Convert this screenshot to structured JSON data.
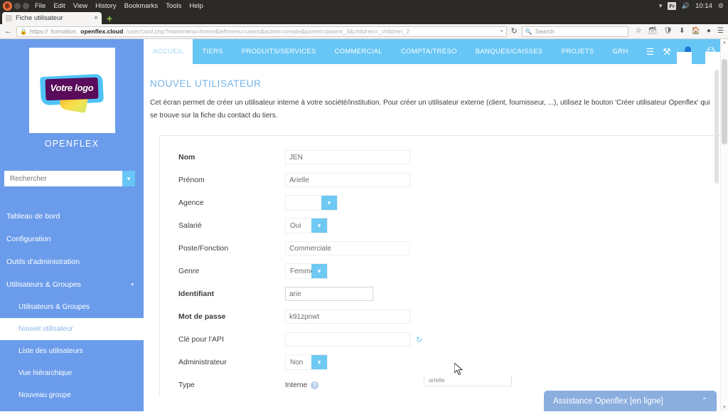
{
  "os": {
    "menu": [
      "File",
      "Edit",
      "View",
      "History",
      "Bookmarks",
      "Tools",
      "Help"
    ],
    "clock": "10:14",
    "tray_icons": [
      "wifi-icon",
      "keyboard-layout-fr",
      "volume-icon",
      "settings-gear-icon"
    ],
    "keyboard_layout": "Fr"
  },
  "browser": {
    "tab": {
      "title": "Fiche utilisateur",
      "close_label": "×"
    },
    "new_tab_label": "+",
    "url": {
      "scheme": "https://",
      "subdomain": "formation.",
      "host": "openflex.cloud",
      "path": "/user/card.php?mainmenu=home&leftmenu=users&action=create&parent=parent_3&children=_children_2"
    },
    "search_placeholder": "Search",
    "toolbar_icons": [
      "back-arrow-icon",
      "lock-icon",
      "dropdown-caret-icon",
      "reload-icon",
      "search-icon",
      "bookmark-star-icon",
      "library-icon",
      "shield-icon",
      "download-icon",
      "home-icon",
      "account-icon",
      "hamburger-menu-icon"
    ]
  },
  "sidebar": {
    "logo_text": "Votre logo",
    "brand": "OPENFLEX",
    "search_placeholder": "Rechercher",
    "items": [
      {
        "label": "Tableau de bord",
        "type": "top",
        "expandable": false
      },
      {
        "label": "Configuration",
        "type": "top",
        "expandable": false
      },
      {
        "label": "Outils d'administration",
        "type": "top",
        "expandable": false
      },
      {
        "label": "Utilisateurs & Groupes",
        "type": "top",
        "expandable": true
      }
    ],
    "sub_items": [
      {
        "label": "Utilisateurs & Groupes",
        "active": false
      },
      {
        "label": "Nouvel utilisateur",
        "active": true
      },
      {
        "label": "Liste des utilisateurs",
        "active": false
      },
      {
        "label": "Vue hiérarchique",
        "active": false
      },
      {
        "label": "Nouveau groupe",
        "active": false
      }
    ]
  },
  "topnav": {
    "items": [
      {
        "label": "ACCUEIL",
        "active": true
      },
      {
        "label": "TIERS",
        "active": false
      },
      {
        "label": "PRODUITS/SERVICES",
        "active": false
      },
      {
        "label": "COMMERCIAL",
        "active": false
      },
      {
        "label": "COMPTA/TRÉSO",
        "active": false
      },
      {
        "label": "BANQUES/CAISSES",
        "active": false
      },
      {
        "label": "PROJETS",
        "active": false
      },
      {
        "label": "GRH",
        "active": false
      }
    ],
    "burger_label": "☰",
    "right_icons": [
      "bug-report-icon",
      "user-account-icon",
      "printer-icon",
      "power-logout-icon"
    ]
  },
  "page": {
    "title": "NOUVEL UTILISATEUR",
    "description": "Cet écran permet de créer un utilisateur interne à votre société/institution. Pour créer un utilisateur externe (client, fournisseur, ...), utilisez le bouton 'Créer utilisateur Openflex' qui se trouve sur la fiche du contact du tiers."
  },
  "form": {
    "fields": [
      {
        "label": "Nom",
        "required": true,
        "kind": "text",
        "value": "JEN"
      },
      {
        "label": "Prénom",
        "required": false,
        "kind": "text",
        "value": "Arielle"
      },
      {
        "label": "Agence",
        "required": false,
        "kind": "select",
        "value": ""
      },
      {
        "label": "Salarié",
        "required": false,
        "kind": "select",
        "value": "Oui"
      },
      {
        "label": "Poste/Fonction",
        "required": false,
        "kind": "text",
        "value": "Commerciale"
      },
      {
        "label": "Genre",
        "required": false,
        "kind": "select",
        "value": "Femme"
      },
      {
        "label": "Identifiant",
        "required": true,
        "kind": "text-focused",
        "value": "arie"
      },
      {
        "label": "Mot de passe",
        "required": true,
        "kind": "text",
        "value": "k91zpnwt"
      },
      {
        "label": "Clé pour l'API",
        "required": false,
        "kind": "text-refresh",
        "value": ""
      },
      {
        "label": "Administrateur",
        "required": false,
        "kind": "select",
        "value": "Non"
      },
      {
        "label": "Type",
        "required": false,
        "kind": "plain",
        "value": "Interne",
        "help": "?"
      }
    ],
    "autocomplete_suggestion": "arielle"
  },
  "chat": {
    "label": "Assistance Openflex [en ligne]",
    "chevron": "⌃"
  },
  "colors": {
    "sidebar_blue": "#6b9ceb",
    "topnav_cyan": "#67c6f5",
    "title_blue": "#74b4e8",
    "chat_blue": "#8aaede",
    "logo_purple": "#5b0b5b"
  }
}
